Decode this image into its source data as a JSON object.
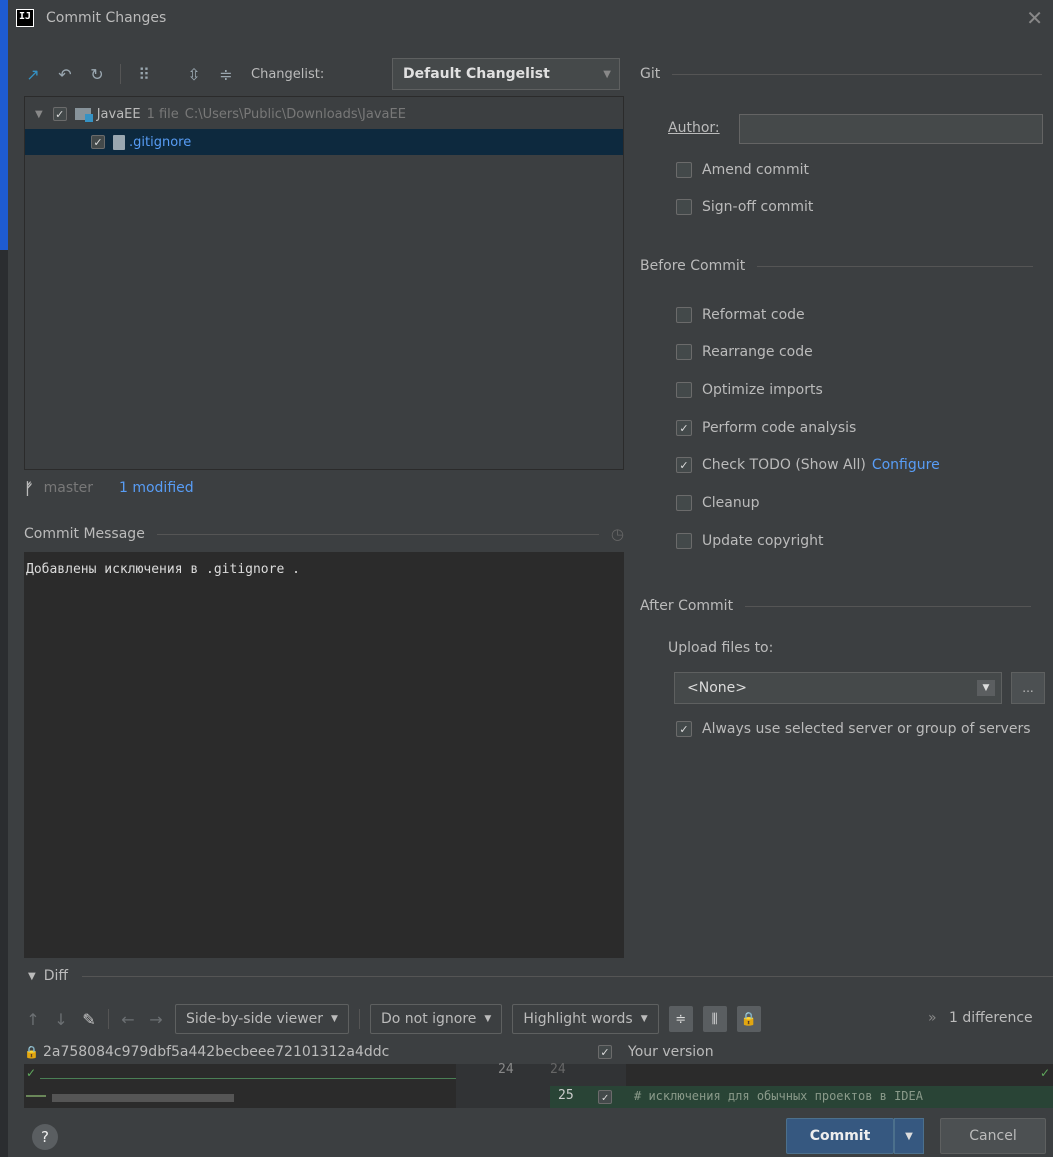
{
  "window": {
    "title": "Commit Changes",
    "logo_text": "IJ"
  },
  "toolbar": {
    "changelist_label": "Changelist:",
    "changelist_value": "Default Changelist"
  },
  "tree": {
    "root": {
      "name": "JavaEE",
      "count": "1 file",
      "path": "C:\\Users\\Public\\Downloads\\JavaEE"
    },
    "file": {
      "name": ".gitignore"
    }
  },
  "branch": {
    "name": "master",
    "status": "1 modified"
  },
  "commit_message": {
    "label": "Commit Message",
    "text": "Добавлены исключения в .gitignore ."
  },
  "git": {
    "header": "Git",
    "author_label": "Author:",
    "author_value": "",
    "amend": "Amend commit",
    "signoff": "Sign-off commit"
  },
  "before_commit": {
    "header": "Before Commit",
    "options": [
      {
        "label": "Reformat code",
        "checked": false
      },
      {
        "label": "Rearrange code",
        "checked": false
      },
      {
        "label": "Optimize imports",
        "checked": false
      },
      {
        "label": "Perform code analysis",
        "checked": true
      },
      {
        "label": "Check TODO (Show All)",
        "checked": true,
        "link": "Configure"
      },
      {
        "label": "Cleanup",
        "checked": false
      },
      {
        "label": "Update copyright",
        "checked": false
      }
    ]
  },
  "after_commit": {
    "header": "After Commit",
    "upload_label": "Upload files to:",
    "upload_value": "<None>",
    "dots": "...",
    "always_use": "Always use selected server or group of servers"
  },
  "diff": {
    "header": "Diff",
    "viewer": "Side-by-side viewer",
    "ignore": "Do not ignore",
    "highlight": "Highlight words",
    "count": "1 difference",
    "hash": "2a758084c979dbf5a442becbeee72101312a4ddc",
    "your_version": "Your version",
    "line_left": "24",
    "line_right_a": "24",
    "line_right_b": "25",
    "added_text": "# исключения для обычных проектов в IDEA"
  },
  "buttons": {
    "help": "?",
    "commit": "Commit",
    "cancel": "Cancel"
  },
  "colors": {
    "accent": "#365880",
    "link": "#589df6",
    "selection": "#0d293e",
    "added": "#294436"
  }
}
